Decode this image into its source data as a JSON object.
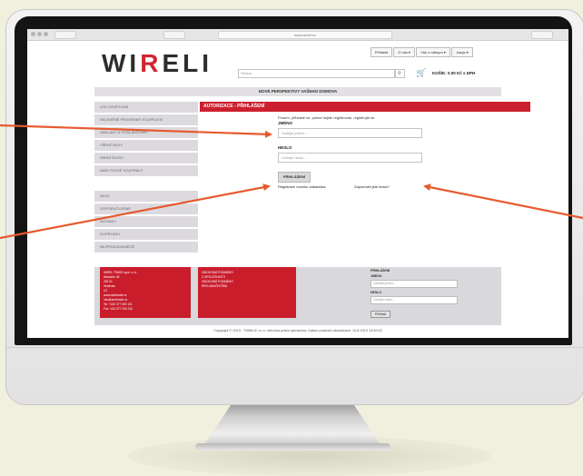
{
  "browser": {
    "url": "www.wireli.cz"
  },
  "header": {
    "logo_left": "WI",
    "logo_accent": "R",
    "logo_right": "ELI",
    "top_links": [
      "Přihlásit",
      "O nás ▾",
      "Vše o nákupu ▾",
      "Jazyk ▾"
    ],
    "search_placeholder": "Hledat...",
    "cart_label": "KOŠÍK: 0.00 Kč s DPH"
  },
  "banner": "NOVÉ PERSPEKTIVY VAŠEHO DOMOVA",
  "sidebar": {
    "items_top": [
      "LED OSVĚTLENÍ",
      "SKLENĚNÉ PROGRAMY KOUPELEN",
      "OBKLADY & PODLAHOVINY",
      "VÍŘIVÉ BOXY",
      "PARNÍ ŠATNY",
      "NÁBYTKOVÉ SOUPRAVY"
    ],
    "items_bottom": [
      "AKCE",
      "DOPORUČUJEME",
      "NOVINKY",
      "DOPRODEJ",
      "NEJPRODÁVANĚJŠÍ"
    ]
  },
  "main": {
    "page_title": "AUTORIZACE - PŘIHLÁŠENÍ",
    "intro_line1": "Prosím, přihlaste se, pokud nejste registrován, registrujte se.",
    "name_label": "JMÉNO",
    "name_placeholder": "Zadejte jméno...",
    "password_label": "HESLO",
    "password_placeholder": "Zadejte heslo...",
    "login_button": "PŘIHLÁŠENÍ",
    "register_link": "Registrace nového zákazníka",
    "forgot_link": "Zapomněli jste heslo?"
  },
  "footer": {
    "company_lines": [
      "WIREL TRADE spol. s r.o.",
      "Nádražní 45",
      "253 01",
      "Hostivice",
      "CZ",
      "www.wireltrade.cz",
      "info@wireltrade.cz",
      "Tel. +420 377 000 101",
      "Fax +420 377 000 210"
    ],
    "links": [
      "OBCHODNÍ PODMÍNKY",
      "O SPOLEČNOSTI",
      "OBCHODNÍ PODMÍNKY",
      "REKLAMAČNÍ ŘÁD"
    ],
    "login_title": "PŘIHLÁŠENÍ",
    "login_name_label": "JMÉNO",
    "login_name_placeholder": "Zadejte jméno...",
    "login_password_label": "HESLO",
    "login_password_placeholder": "Zadejte heslo...",
    "login_button": "Přihlásit"
  },
  "copyright": "Copyright © 2013 · TWIBLIC s.r.o. všechna práva vyhrazena.  Datum poslední aktualizace: 10.8.2013 13:40:02",
  "colors": {
    "brand_red": "#cc1f2d",
    "arrow": "#e65a2e",
    "background": "#f1f0df"
  }
}
